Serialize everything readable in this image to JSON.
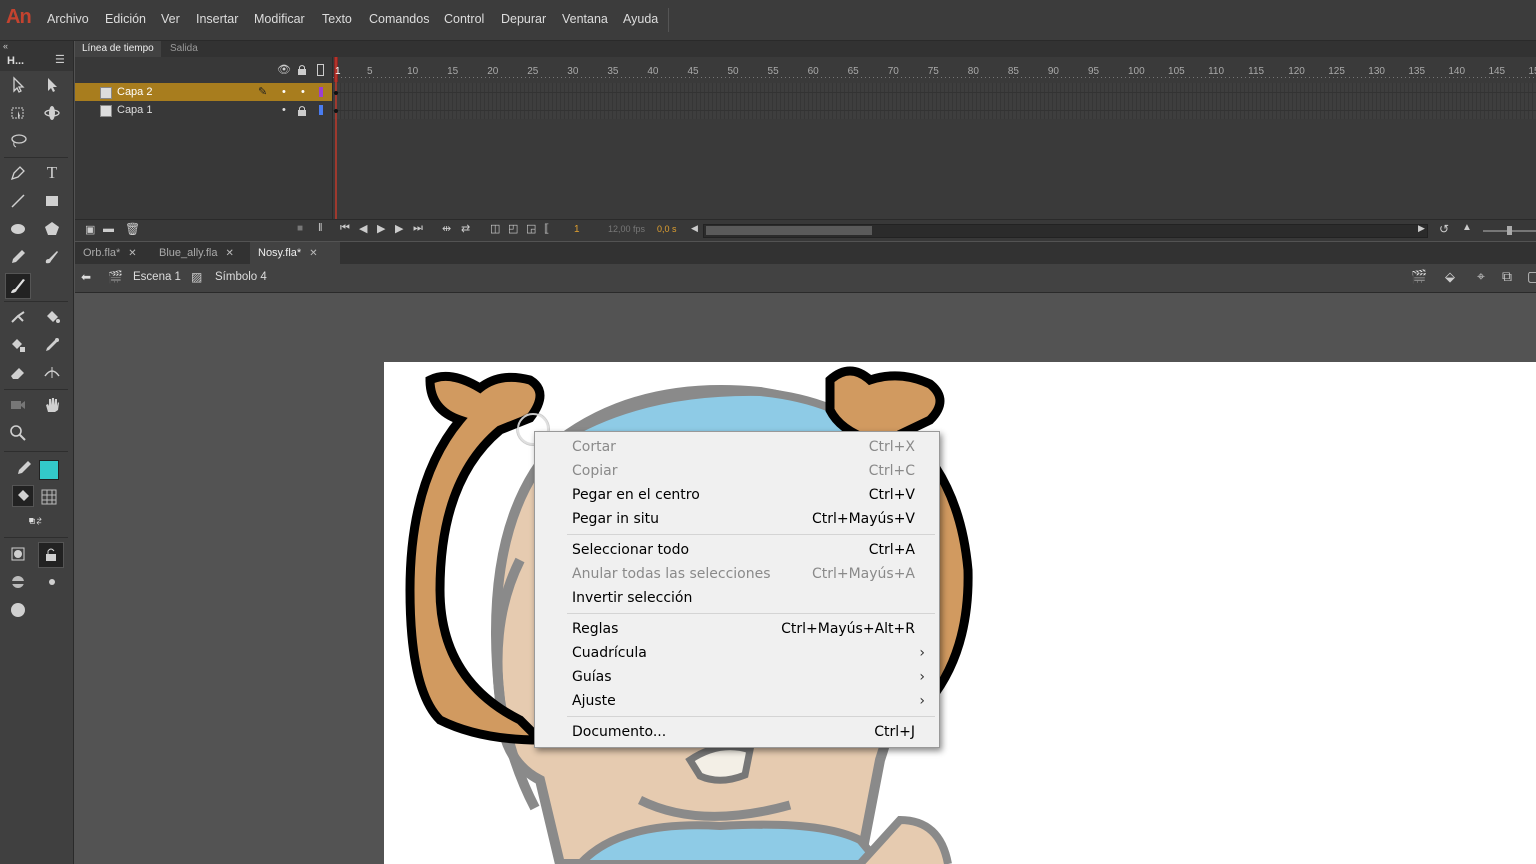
{
  "app": {
    "logo": "An"
  },
  "menubar": {
    "items": [
      "Archivo",
      "Edición",
      "Ver",
      "Insertar",
      "Modificar",
      "Texto",
      "Comandos",
      "Control",
      "Depurar",
      "Ventana",
      "Ayuda"
    ]
  },
  "tools_panel": {
    "title": "H..."
  },
  "timeline_panel": {
    "tabs": [
      "Línea de tiempo",
      "Salida"
    ],
    "layers": [
      {
        "name": "Capa 2",
        "selected": true,
        "color": "#9b3fd1"
      },
      {
        "name": "Capa 1",
        "selected": false,
        "color": "#4a7cf0"
      }
    ],
    "ruler_ticks": [
      "1",
      "5",
      "10",
      "15",
      "20",
      "25",
      "30",
      "35",
      "40",
      "45",
      "50",
      "55",
      "60",
      "65",
      "70",
      "75",
      "80",
      "85",
      "90",
      "95",
      "100",
      "105",
      "110",
      "115",
      "120",
      "125",
      "130",
      "135",
      "140",
      "145",
      "15"
    ],
    "current_frame": "1",
    "fps": "12,00 fps",
    "time": "0,0 s"
  },
  "document_tabs": [
    {
      "label": "Orb.fla*",
      "active": false
    },
    {
      "label": "Blue_ally.fla",
      "active": false
    },
    {
      "label": "Nosy.fla*",
      "active": true
    }
  ],
  "edit_bar": {
    "scene": "Escena 1",
    "symbol": "Símbolo 4"
  },
  "colors": {
    "fill": "#33c9c9",
    "accent_layer": "#a87d1e",
    "playhead": "#c0392b"
  },
  "context_menu": {
    "groups": [
      [
        {
          "label": "Cortar",
          "shortcut": "Ctrl+X",
          "disabled": true
        },
        {
          "label": "Copiar",
          "shortcut": "Ctrl+C",
          "disabled": true
        },
        {
          "label": "Pegar en el centro",
          "shortcut": "Ctrl+V",
          "disabled": false
        },
        {
          "label": "Pegar in situ",
          "shortcut": "Ctrl+Mayús+V",
          "disabled": false
        }
      ],
      [
        {
          "label": "Seleccionar todo",
          "shortcut": "Ctrl+A",
          "disabled": false
        },
        {
          "label": "Anular todas las selecciones",
          "shortcut": "Ctrl+Mayús+A",
          "disabled": true
        },
        {
          "label": "Invertir selección",
          "shortcut": "",
          "disabled": false
        }
      ],
      [
        {
          "label": "Reglas",
          "shortcut": "Ctrl+Mayús+Alt+R",
          "disabled": false
        },
        {
          "label": "Cuadrícula",
          "shortcut": "",
          "submenu": true
        },
        {
          "label": "Guías",
          "shortcut": "",
          "submenu": true
        },
        {
          "label": "Ajuste",
          "shortcut": "",
          "submenu": true
        }
      ],
      [
        {
          "label": "Documento...",
          "shortcut": "Ctrl+J",
          "disabled": false
        }
      ]
    ]
  }
}
